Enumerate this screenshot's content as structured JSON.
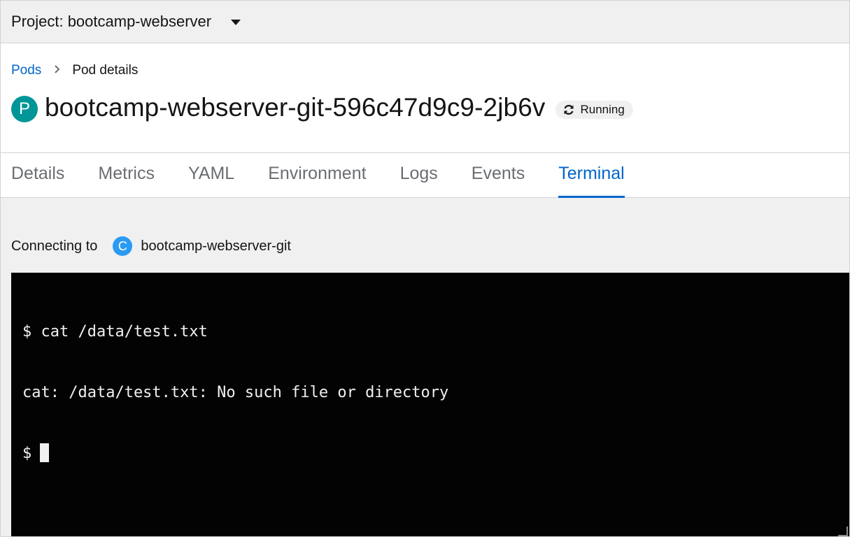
{
  "project_bar": {
    "label": "Project: bootcamp-webserver",
    "icon": "caret-down-icon"
  },
  "breadcrumb": {
    "parent": "Pods",
    "separator_icon": "chevron-right-icon",
    "current": "Pod details"
  },
  "header": {
    "resource_badge": "P",
    "title": "bootcamp-webserver-git-596c47d9c9-2jb6v",
    "status": "Running",
    "status_icon": "sync-icon"
  },
  "tabs": [
    {
      "label": "Details"
    },
    {
      "label": "Metrics"
    },
    {
      "label": "YAML"
    },
    {
      "label": "Environment"
    },
    {
      "label": "Logs"
    },
    {
      "label": "Events"
    },
    {
      "label": "Terminal"
    }
  ],
  "active_tab": "Terminal",
  "terminal_section": {
    "connecting_label": "Connecting to",
    "container_badge": "C",
    "container_name": "bootcamp-webserver-git"
  },
  "terminal": {
    "lines": [
      "$ cat /data/test.txt",
      "cat: /data/test.txt: No such file or directory"
    ],
    "prompt": "$"
  },
  "colors": {
    "link": "#0066cc",
    "pod_badge": "#009596",
    "container_badge": "#2b9af3",
    "terminal_bg": "#030303"
  }
}
